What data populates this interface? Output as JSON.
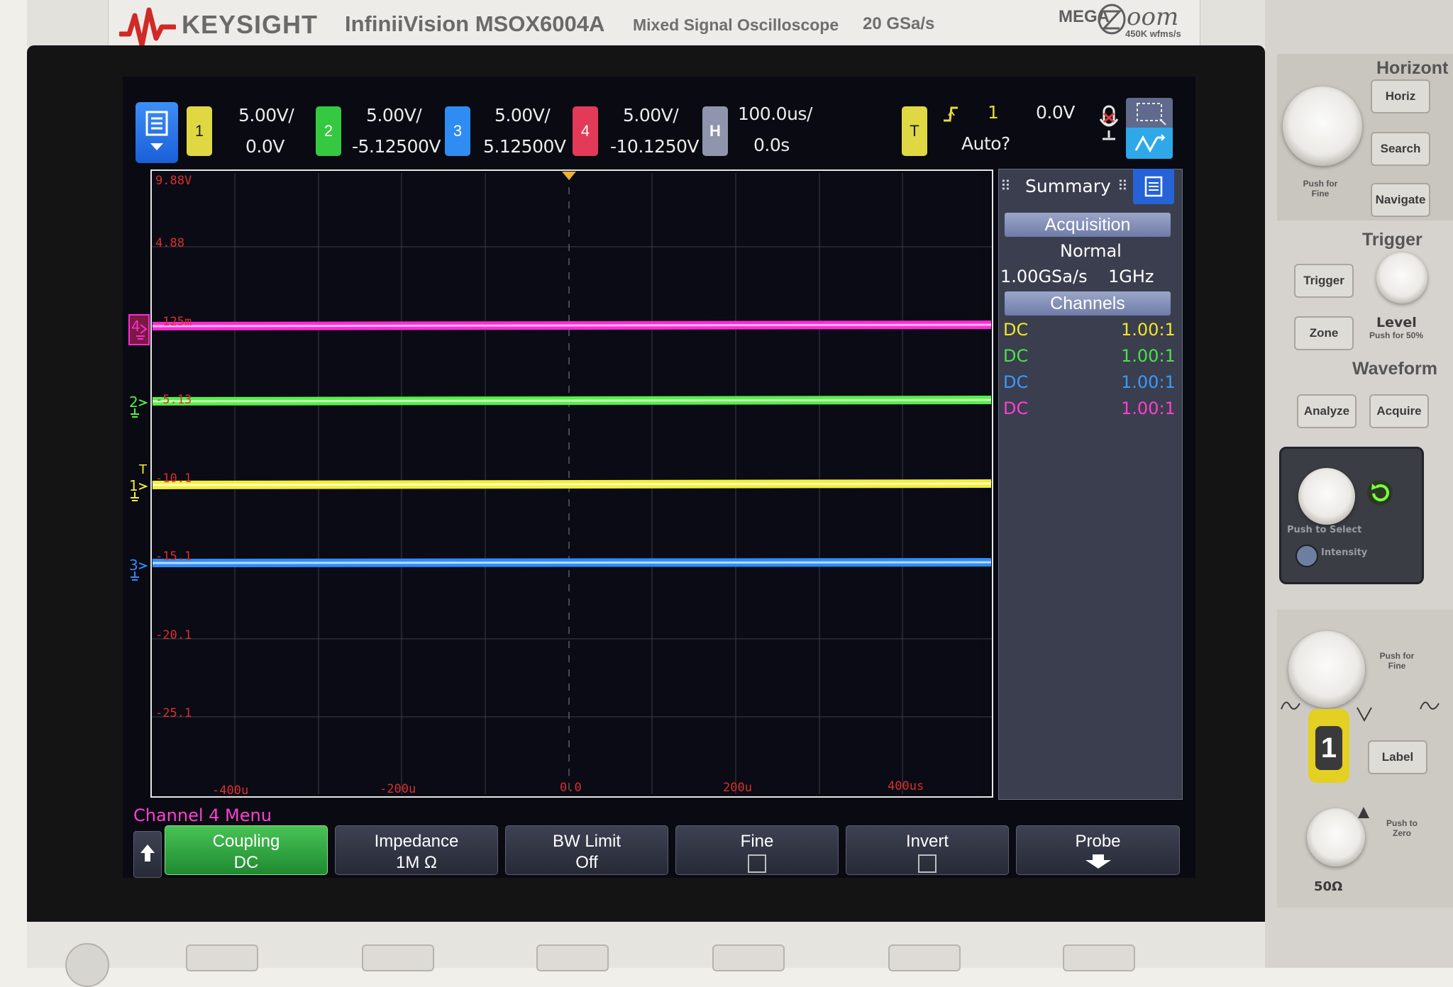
{
  "brand": {
    "name": "KEYSIGHT",
    "model": "InfiniiVision MSOX6004A",
    "description": "Mixed Signal Oscilloscope",
    "sample_rate": "20 GSa/s",
    "megazoom_prefix": "MEGA",
    "megazoom_suffix": "oom",
    "megazoom_rate": "450K wfms/s"
  },
  "status_bar": {
    "channels": [
      {
        "number": "1",
        "scale": "5.00V/",
        "offset": "0.0V",
        "color": "#e8e23a"
      },
      {
        "number": "2",
        "scale": "5.00V/",
        "offset": "-5.12500V",
        "color": "#3fd64a"
      },
      {
        "number": "3",
        "scale": "5.00V/",
        "offset": "5.12500V",
        "color": "#2f8cf2"
      },
      {
        "number": "4",
        "scale": "5.00V/",
        "offset": "-10.1250V",
        "color": "#e83a5c"
      }
    ],
    "horizontal": {
      "label": "H",
      "scale": "100.0us/",
      "delay": "0.0s"
    },
    "trigger": {
      "label": "T",
      "slope_icon": "rising-edge-trigger-icon",
      "source": "1",
      "level": "0.0V",
      "mode": "Auto?"
    }
  },
  "grid": {
    "y_labels": [
      "9.88V",
      "4.88",
      "-125m",
      "-5.13",
      "-10.1",
      "-15.1",
      "-20.1",
      "-25.1"
    ],
    "x_labels": [
      "-400u",
      "-200u",
      "0.0",
      "200u",
      "400us"
    ]
  },
  "traces": [
    {
      "name": "4",
      "color": "#ff2bd6"
    },
    {
      "name": "2",
      "color": "#55f04a"
    },
    {
      "name": "1",
      "color": "#f3ee3a"
    },
    {
      "name": "3",
      "color": "#2f8cff"
    }
  ],
  "markers": {
    "trigger_t": "T"
  },
  "summary": {
    "title": "Summary",
    "acquisition_header": "Acquisition",
    "mode": "Normal",
    "rate": "1.00GSa/s",
    "bandwidth": "1GHz",
    "channels_header": "Channels",
    "channels": [
      {
        "coupling": "DC",
        "probe": "1.00:1",
        "color": "#f0e62c"
      },
      {
        "coupling": "DC",
        "probe": "1.00:1",
        "color": "#4be04b"
      },
      {
        "coupling": "DC",
        "probe": "1.00:1",
        "color": "#3a99ff"
      },
      {
        "coupling": "DC",
        "probe": "1.00:1",
        "color": "#ff3fd0"
      }
    ]
  },
  "menu": {
    "title": "Channel 4 Menu",
    "softkeys": [
      {
        "label": "Coupling",
        "value": "DC"
      },
      {
        "label": "Impedance",
        "value": "1M Ω"
      },
      {
        "label": "BW Limit",
        "value": "Off"
      },
      {
        "label": "Fine",
        "value": ""
      },
      {
        "label": "Invert",
        "value": ""
      },
      {
        "label": "Probe",
        "value": ""
      }
    ]
  },
  "front_panel": {
    "horizontal_title": "Horizont",
    "horiz": "Horiz",
    "search": "Search",
    "navigate": "Navigate",
    "push_for_fine": "Push for Fine",
    "trigger_title": "Trigger",
    "trigger_btn": "Trigger",
    "zone": "Zone",
    "level": "Level",
    "push_for_50": "Push for 50%",
    "waveform_title": "Waveform",
    "analyze": "Analyze",
    "acquire": "Acquire",
    "push_to_select": "Push to Select",
    "intensity": "Intensity",
    "push_for_fine_2": "Push for Fine",
    "channel_1": "1",
    "label_btn": "Label",
    "push_to_zero": "Push to Zero",
    "impedance_50": "50Ω"
  }
}
